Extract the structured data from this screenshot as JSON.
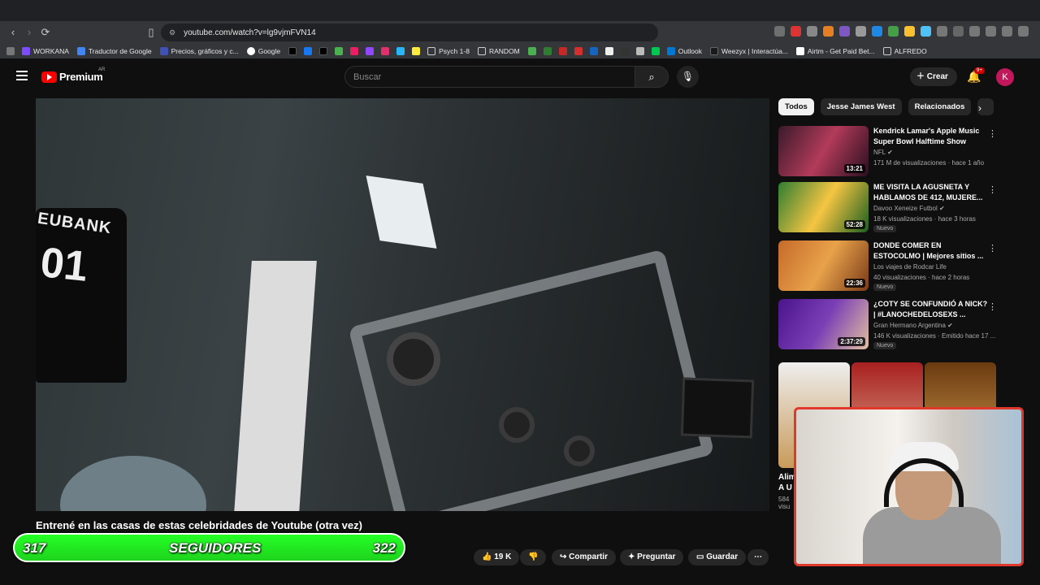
{
  "browser": {
    "url": "youtube.com/watch?v=lg9vjmFVN14",
    "bookmarks": [
      "WORKANA",
      "Traductor de Google",
      "Precios, gráficos y c...",
      "Google",
      "Psych 1-8",
      "RANDOM",
      "Outlook",
      "Weezyx | Interactúa...",
      "Airtm - Get Paid Bet...",
      "ALFREDO"
    ]
  },
  "header": {
    "logo_text": "Premium",
    "country": "AR",
    "search_placeholder": "Buscar",
    "create_label": "Crear",
    "notif_count": "9+",
    "avatar_letter": "K"
  },
  "video": {
    "title": "Entrené en las casas de estas celebridades de Youtube (otra vez)",
    "shirt_name": "EUBANK",
    "shirt_number": "01"
  },
  "overlay": {
    "left_count": "317",
    "label": "SEGUIDORES",
    "right_count": "322"
  },
  "actions": {
    "likes": "19 K",
    "share": "Compartir",
    "ask": "Preguntar",
    "save": "Guardar"
  },
  "chips": [
    "Todos",
    "Jesse James West",
    "Relacionados"
  ],
  "recommendations": [
    {
      "title": "Kendrick Lamar's Apple Music Super Bowl Halftime Show",
      "channel": "NFL",
      "views": "171 M de visualizaciones · hace 1 año",
      "duration": "13:21",
      "new": ""
    },
    {
      "title": "ME VISITA LA AGUSNETA Y HABLAMOS DE 412, MUJERE...",
      "channel": "Davoo Xeneize Futbol",
      "views": "18 K visualizaciones · hace 3 horas",
      "duration": "52:28",
      "new": "Nuevo"
    },
    {
      "title": "DONDE COMER EN ESTOCOLMO | Mejores sitios ...",
      "channel": "Los viajes de Rodcar Life",
      "views": "40 visualizaciones · hace 2 horas",
      "duration": "22:36",
      "new": "Nuevo"
    },
    {
      "title": "¿COTY SE CONFUNDIÓ A NICK? | #LANOCHEDELOSEXS ...",
      "channel": "Gran Hermano Argentina",
      "views": "146 K visualizaciones · Emitido hace 17 ...",
      "duration": "2:37:29",
      "new": "Nuevo"
    }
  ],
  "side_partial": {
    "line1": "Alim",
    "line2": "A U",
    "line3": "584",
    "line4": "visu"
  },
  "colors": {
    "accent": "#ff0000",
    "overlay_green": "#22ee22",
    "cam_border": "#e0392b"
  }
}
